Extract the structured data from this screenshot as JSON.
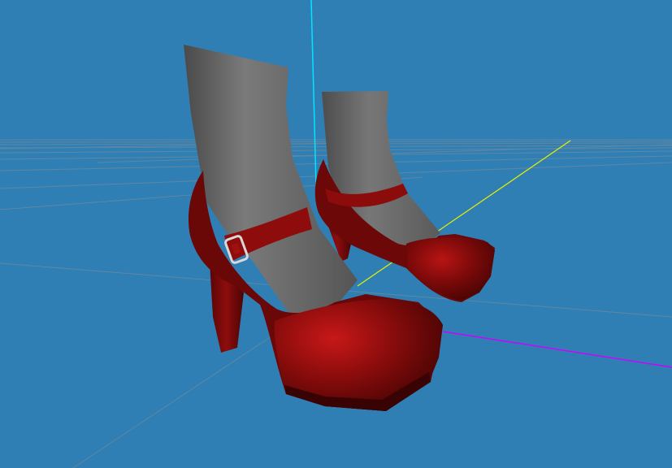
{
  "viewport": {
    "background_color": "#2f7fb4",
    "grid_color": "#6f8a9c",
    "axis_colors": {
      "x": "#d000ff",
      "y": "#00e5ff",
      "z": "#e8f000"
    }
  },
  "model": {
    "shoe_color": "#7a0a0a",
    "shoe_highlight_color": "#c01010",
    "sock_color": "#6a6a6a",
    "buckle_color": "#d8d8d8",
    "shoe_count": 2
  }
}
